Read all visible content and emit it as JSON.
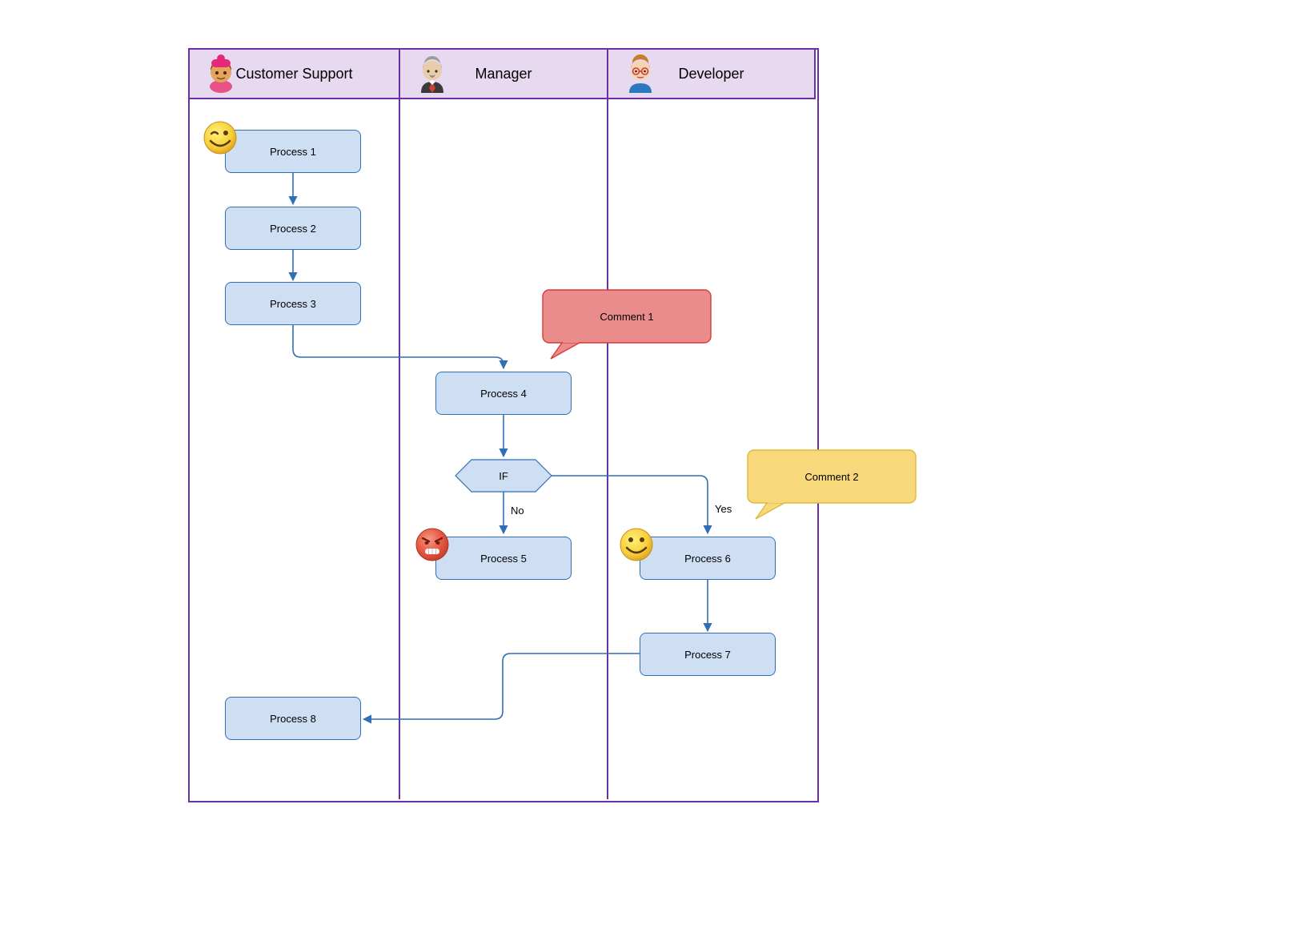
{
  "lanes": {
    "lane1": {
      "title": "Customer Support"
    },
    "lane2": {
      "title": "Manager"
    },
    "lane3": {
      "title": "Developer"
    }
  },
  "nodes": {
    "p1": "Process 1",
    "p2": "Process 2",
    "p3": "Process 3",
    "p4": "Process 4",
    "p5": "Process 5",
    "p6": "Process 6",
    "p7": "Process 7",
    "p8": "Process 8",
    "if": "IF"
  },
  "edges": {
    "no": "No",
    "yes": "Yes"
  },
  "comments": {
    "c1": "Comment 1",
    "c2": "Comment 2"
  },
  "colors": {
    "laneBorder": "#6B2FA6",
    "laneHeaderBg": "#E6D9F0",
    "processFill": "#CFDFF3",
    "processStroke": "#2F6FB7",
    "arrowStroke": "#2F6FB7",
    "comment1Fill": "#EB8C8C",
    "comment1Stroke": "#D83A3A",
    "comment2Fill": "#F7D87B",
    "comment2Stroke": "#E0B93A"
  }
}
